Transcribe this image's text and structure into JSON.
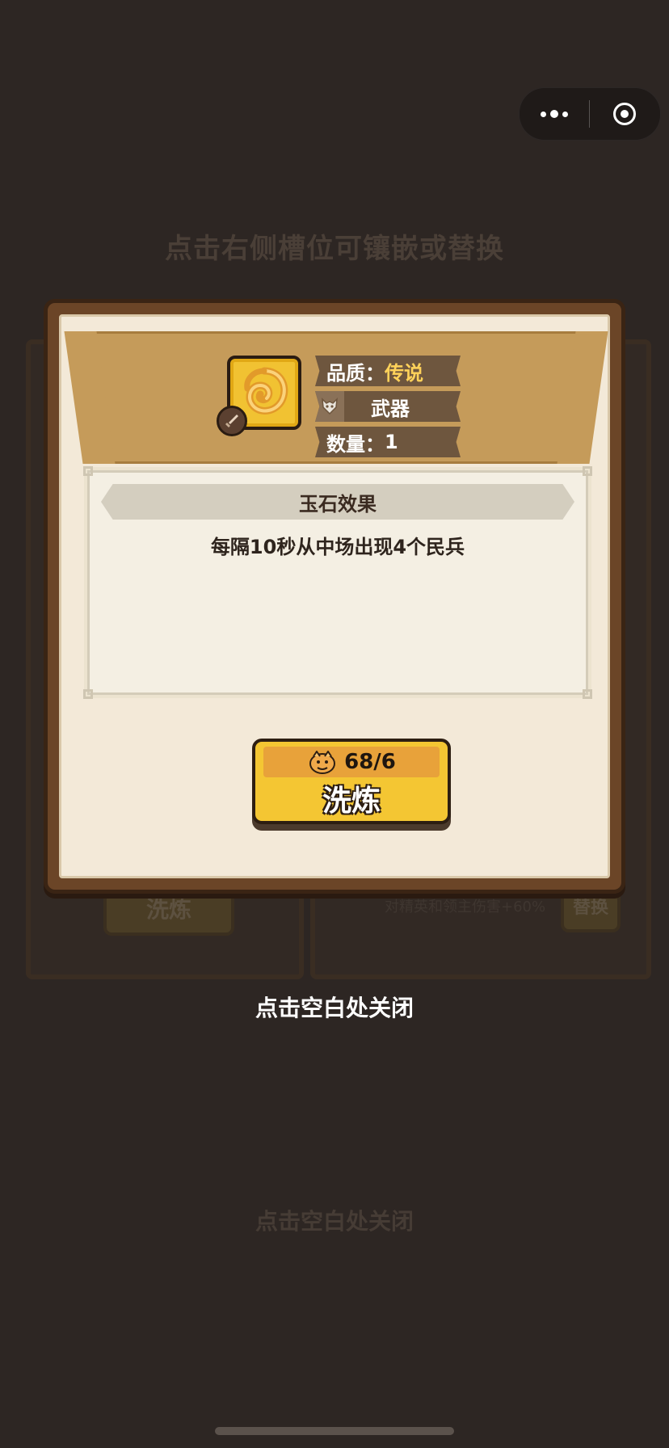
{
  "background": {
    "hint_text": "点击右侧槽位可镶嵌或替换",
    "left_card_button": "洗炼",
    "right_card_text": "对精英和领主伤害+60%",
    "right_card_button": "替换",
    "close_hint": "点击空白处关闭"
  },
  "capsule": {
    "more_icon": "more-dots-icon",
    "close_icon": "target-close-icon"
  },
  "dialog": {
    "item_icon": "jade-swirl-icon",
    "type_badge_icon": "sword-badge-icon",
    "quality_label": "品质：",
    "quality_value": "传说",
    "type_icon": "wolf-head-icon",
    "type_value": "武器",
    "count_label": "数量：",
    "count_value": "1",
    "effect_title": "玉石效果",
    "effect_text": "每隔10秒从中场出现4个民兵",
    "refine_cost": "68/6",
    "refine_cost_icon": "dragon-token-icon",
    "refine_label": "洗炼"
  },
  "close_hint": "点击空白处关闭",
  "colors": {
    "overlay_bg": "#2d2623",
    "dialog_frame": "#6b4527",
    "header_band": "#c59b5a",
    "button_yellow": "#f4c633",
    "quality_accent": "#ffd25a"
  }
}
